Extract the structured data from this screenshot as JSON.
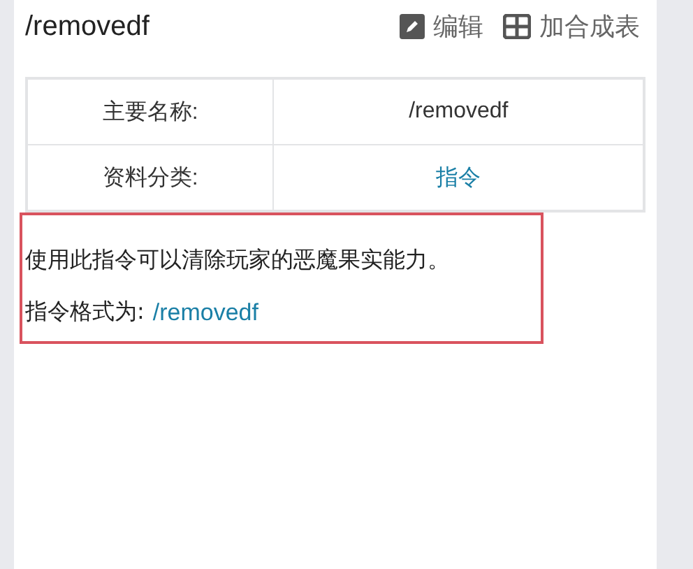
{
  "title": "/removedf",
  "actions": [
    {
      "kind": "edit",
      "label": "编辑"
    },
    {
      "kind": "table",
      "label": "加合成表"
    }
  ],
  "table": {
    "rows": [
      {
        "label": "主要名称:",
        "value": "/removedf",
        "kind": "text"
      },
      {
        "label": "资料分类:",
        "value": "指令",
        "kind": "link"
      }
    ]
  },
  "info": {
    "highlighted": true,
    "description": "使用此指令可以清除玩家的恶魔果实能力。",
    "format_label": "指令格式为:",
    "format_value": "/removedf"
  }
}
